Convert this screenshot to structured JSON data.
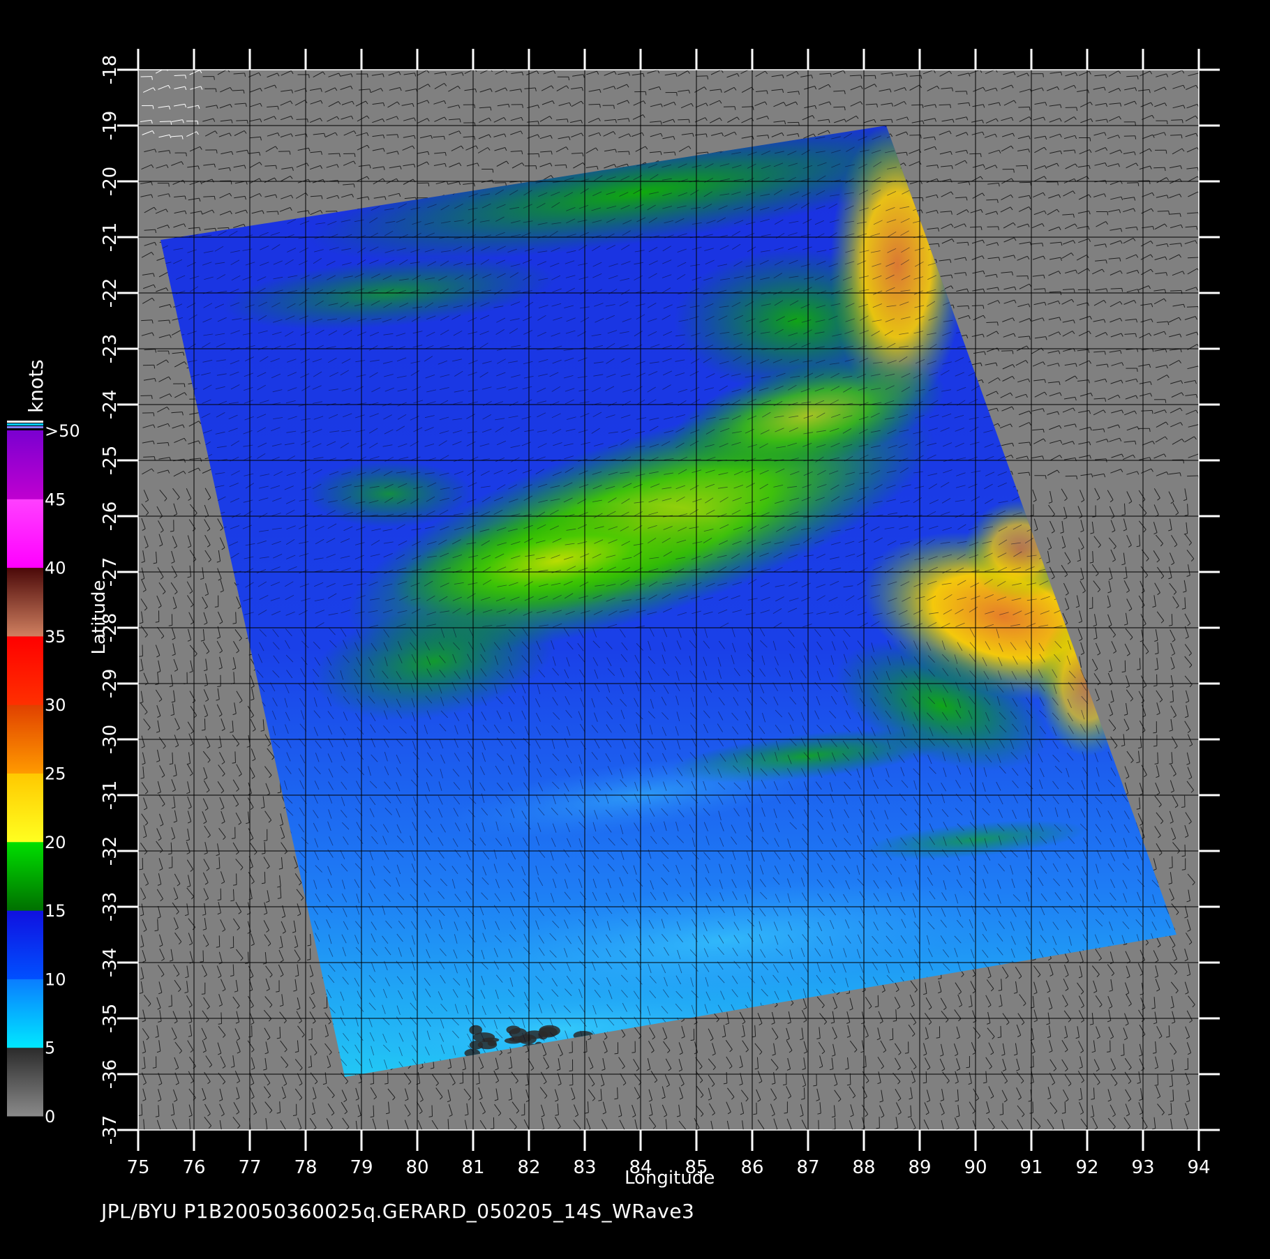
{
  "map": {
    "xlabel": "Longitude",
    "ylabel": "Latitude",
    "lon_range": [
      75,
      94
    ],
    "lat_range": [
      -37,
      -18
    ],
    "lon_ticks": [
      "75",
      "76",
      "77",
      "78",
      "79",
      "80",
      "81",
      "82",
      "83",
      "84",
      "85",
      "86",
      "87",
      "88",
      "89",
      "90",
      "91",
      "92",
      "93",
      "94"
    ],
    "lat_ticks": [
      "-18",
      "-19",
      "-20",
      "-21",
      "-22",
      "-23",
      "-24",
      "-25",
      "-26",
      "-27",
      "-28",
      "-29",
      "-30",
      "-31",
      "-32",
      "-33",
      "-34",
      "-35",
      "-36",
      "-37"
    ],
    "background_color": "#808080",
    "grid_color": "#000000",
    "swath_corners_lonlat": [
      [
        75.4,
        -21.05
      ],
      [
        88.4,
        -19.0
      ],
      [
        93.6,
        -33.5
      ],
      [
        78.7,
        -36.05
      ]
    ]
  },
  "colorbar": {
    "title": "knots",
    "labels": [
      ">50",
      "45",
      "40",
      "35",
      "30",
      "25",
      "20",
      "15",
      "10",
      "5",
      "0"
    ],
    "segments": [
      {
        "from": 0,
        "to": 5,
        "top": "#2a2a2a",
        "bottom": "#8a8a8a"
      },
      {
        "from": 5,
        "to": 10,
        "top": "#0a7cff",
        "bottom": "#00e8ff"
      },
      {
        "from": 10,
        "to": 15,
        "top": "#1010e0",
        "bottom": "#0050ff"
      },
      {
        "from": 15,
        "to": 20,
        "top": "#00e000",
        "bottom": "#007000"
      },
      {
        "from": 20,
        "to": 25,
        "top": "#ffc800",
        "bottom": "#ffff20"
      },
      {
        "from": 25,
        "to": 30,
        "top": "#e04000",
        "bottom": "#ff9a00"
      },
      {
        "from": 30,
        "to": 35,
        "top": "#ff0000",
        "bottom": "#ff3000"
      },
      {
        "from": 35,
        "to": 40,
        "top": "#4a0808",
        "bottom": "#d08060"
      },
      {
        "from": 40,
        "to": 45,
        "top": "#ff40ff",
        "bottom": "#ff00ff"
      },
      {
        "from": 45,
        "to": 50,
        "top": "#7a00d0",
        "bottom": "#c000d0"
      }
    ],
    "cap_colors": [
      "#ffffff",
      "#00c8ff",
      "#8080ff"
    ]
  },
  "footer": "JPL/BYU  P1B20050360025q.GERARD_050205_14S_WRave3"
}
